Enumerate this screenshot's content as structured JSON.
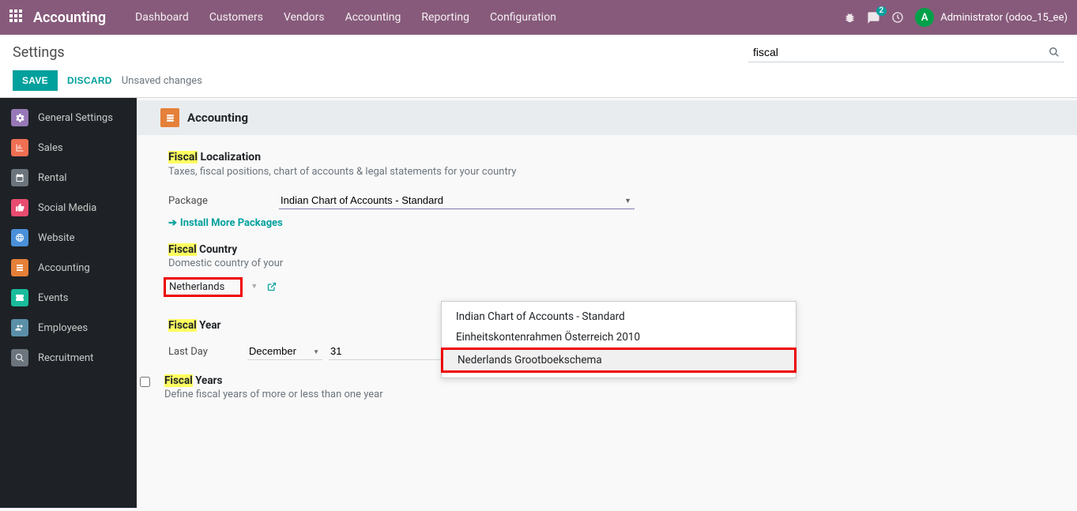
{
  "navbar": {
    "brand": "Accounting",
    "menu": [
      "Dashboard",
      "Customers",
      "Vendors",
      "Accounting",
      "Reporting",
      "Configuration"
    ],
    "messages_badge": "2",
    "avatar_letter": "A",
    "user": "Administrator (odoo_15_ee)"
  },
  "cp": {
    "breadcrumb": "Settings",
    "search_value": "fiscal",
    "save": "SAVE",
    "discard": "DISCARD",
    "status": "Unsaved changes"
  },
  "sidebar": {
    "items": [
      {
        "label": "General Settings",
        "color": "#6b5b95"
      },
      {
        "label": "Sales",
        "color": "#ef6f53"
      },
      {
        "label": "Rental",
        "color": "#6c757d"
      },
      {
        "label": "Social Media",
        "color": "#e74c6f"
      },
      {
        "label": "Website",
        "color": "#4a90d9"
      },
      {
        "label": "Accounting",
        "color": "#e48039"
      },
      {
        "label": "Events",
        "color": "#1abc9c"
      },
      {
        "label": "Employees",
        "color": "#5b8fa8"
      },
      {
        "label": "Recruitment",
        "color": "#6c757d"
      }
    ]
  },
  "content": {
    "app_title": "Accounting",
    "localization": {
      "heading_hl": "Fiscal",
      "heading_rest": " Localization",
      "desc": "Taxes, fiscal positions, chart of accounts & legal statements for your country",
      "package_label": "Package",
      "package_value": "Indian Chart of Accounts - Standard",
      "more_packages": "Install More Packages",
      "dropdown": [
        "Indian Chart of Accounts - Standard",
        "Einheitskontenrahmen Österreich 2010",
        "Nederlands Grootboekschema"
      ]
    },
    "country": {
      "heading_hl": "Fiscal",
      "heading_rest": " Country",
      "desc": "Domestic country of your",
      "value": "Netherlands"
    },
    "year": {
      "heading_hl": "Fiscal",
      "heading_rest": " Year",
      "lastday_label": "Last Day",
      "month": "December",
      "day": "31"
    },
    "years": {
      "heading_hl": "Fiscal",
      "heading_rest": " Years",
      "desc": "Define fiscal years of more or less than one year"
    }
  }
}
